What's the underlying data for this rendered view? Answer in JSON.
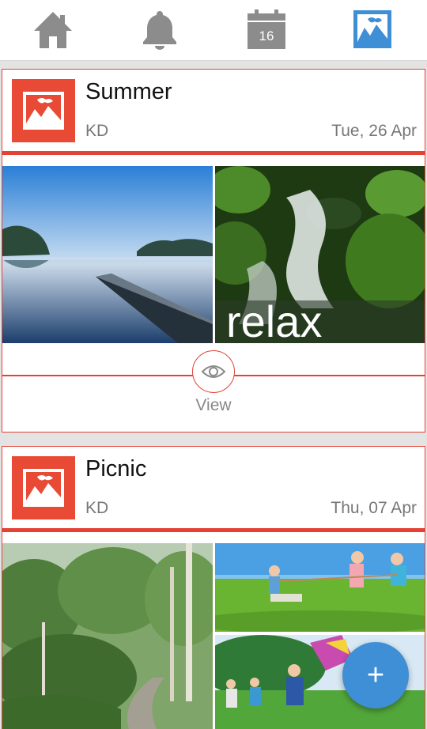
{
  "nav": {
    "items": [
      {
        "name": "home",
        "icon": "home-icon"
      },
      {
        "name": "notifications",
        "icon": "bell-icon"
      },
      {
        "name": "calendar",
        "icon": "calendar-icon",
        "day": "16"
      },
      {
        "name": "gallery",
        "icon": "gallery-icon",
        "active": true
      }
    ],
    "inactive_color": "#8c8c8c",
    "active_color": "#3f8fd6"
  },
  "albums": [
    {
      "title": "Summer",
      "owner": "KD",
      "date": "Tue, 26 Apr",
      "photos": [
        {
          "name": "lake-pier-photo"
        },
        {
          "name": "waterfall-relax-photo",
          "caption": "relax"
        }
      ],
      "view_label": "View"
    },
    {
      "title": "Picnic",
      "owner": "KD",
      "date": "Thu, 07 Apr",
      "photos": [
        {
          "name": "forest-road-photo"
        },
        {
          "name": "kids-tug-of-war-photo"
        },
        {
          "name": "kite-flying-photo"
        }
      ]
    }
  ],
  "fab": {
    "label": "+",
    "icon": "add-icon"
  },
  "colors": {
    "accent": "#e34234",
    "fab": "#3f8fd6"
  }
}
